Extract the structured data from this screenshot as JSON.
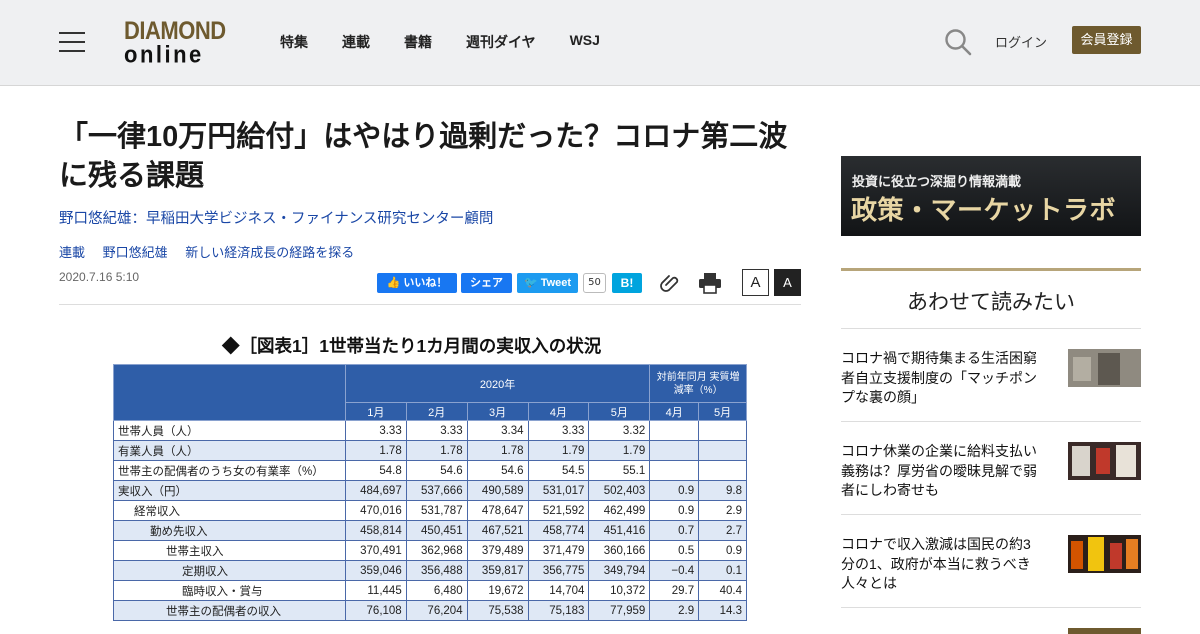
{
  "header": {
    "logo_line1": "DIAMOND",
    "logo_line2": "online",
    "nav": [
      "特集",
      "連載",
      "書籍",
      "週刊ダイヤ",
      "WSJ"
    ],
    "login": "ログイン",
    "register": "会員登録"
  },
  "article": {
    "title": "「一律10万円給付」はやはり過剰だった？コロナ第二波に残る課題",
    "author": "野口悠紀雄：早稲田大学ビジネス・ファイナンス研究センター顧問",
    "tags": [
      "連載",
      "野口悠紀雄",
      "新しい経済成長の経路を探る"
    ],
    "date": "2020.7.16 5:10"
  },
  "share": {
    "fb_like": "いいね！",
    "fb_share": "シェア",
    "tweet": "Tweet",
    "tweet_count": "50",
    "hatena": "B!",
    "font_small": "A",
    "font_large": "A"
  },
  "figure": {
    "caption": "◆［図表1］1世帯当たり1カ月間の実収入の状況",
    "header_year": "2020年",
    "header_change": "対前年同月 実質増減率（%）",
    "months": [
      "1月",
      "2月",
      "3月",
      "4月",
      "5月"
    ],
    "change_months": [
      "4月",
      "5月"
    ],
    "rows": [
      {
        "label": "世帯人員（人）",
        "indent": 0,
        "values": [
          "3.33",
          "3.33",
          "3.34",
          "3.33",
          "3.32",
          "",
          ""
        ]
      },
      {
        "label": "有業人員（人）",
        "indent": 0,
        "values": [
          "1.78",
          "1.78",
          "1.78",
          "1.79",
          "1.79",
          "",
          ""
        ]
      },
      {
        "label": "世帯主の配偶者のうち女の有業率（%）",
        "indent": 0,
        "values": [
          "54.8",
          "54.6",
          "54.6",
          "54.5",
          "55.1",
          "",
          ""
        ]
      },
      {
        "label": "実収入（円）",
        "indent": 0,
        "values": [
          "484,697",
          "537,666",
          "490,589",
          "531,017",
          "502,403",
          "0.9",
          "9.8"
        ]
      },
      {
        "label": "経常収入",
        "indent": 1,
        "values": [
          "470,016",
          "531,787",
          "478,647",
          "521,592",
          "462,499",
          "0.9",
          "2.9"
        ]
      },
      {
        "label": "勤め先収入",
        "indent": 2,
        "values": [
          "458,814",
          "450,451",
          "467,521",
          "458,774",
          "451,416",
          "0.7",
          "2.7"
        ]
      },
      {
        "label": "世帯主収入",
        "indent": 3,
        "values": [
          "370,491",
          "362,968",
          "379,489",
          "371,479",
          "360,166",
          "0.5",
          "0.9"
        ]
      },
      {
        "label": "定期収入",
        "indent": 4,
        "values": [
          "359,046",
          "356,488",
          "359,817",
          "356,775",
          "349,794",
          "−0.4",
          "0.1"
        ]
      },
      {
        "label": "臨時収入・賞与",
        "indent": 4,
        "values": [
          "11,445",
          "6,480",
          "19,672",
          "14,704",
          "10,372",
          "29.7",
          "40.4"
        ]
      },
      {
        "label": "世帯主の配偶者の収入",
        "indent": 3,
        "values": [
          "76,108",
          "76,204",
          "75,538",
          "75,183",
          "77,959",
          "2.9",
          "14.3"
        ]
      }
    ]
  },
  "sidebar": {
    "ad_sub": "投資に役立つ深掘り情報満載",
    "ad_main": "政策・マーケットラボ",
    "heading": "あわせて読みたい",
    "items": [
      {
        "title": "コロナ禍で期待集まる生活困窮者自立支援制度の「マッチポンプな裏の顔」"
      },
      {
        "title": "コロナ休業の企業に給料支払い義務は？厚労省の曖昧見解で弱者にしわ寄せも"
      },
      {
        "title": "コロナで収入激減は国民の約3分の1、政府が本当に救うべき人々とは"
      }
    ]
  }
}
